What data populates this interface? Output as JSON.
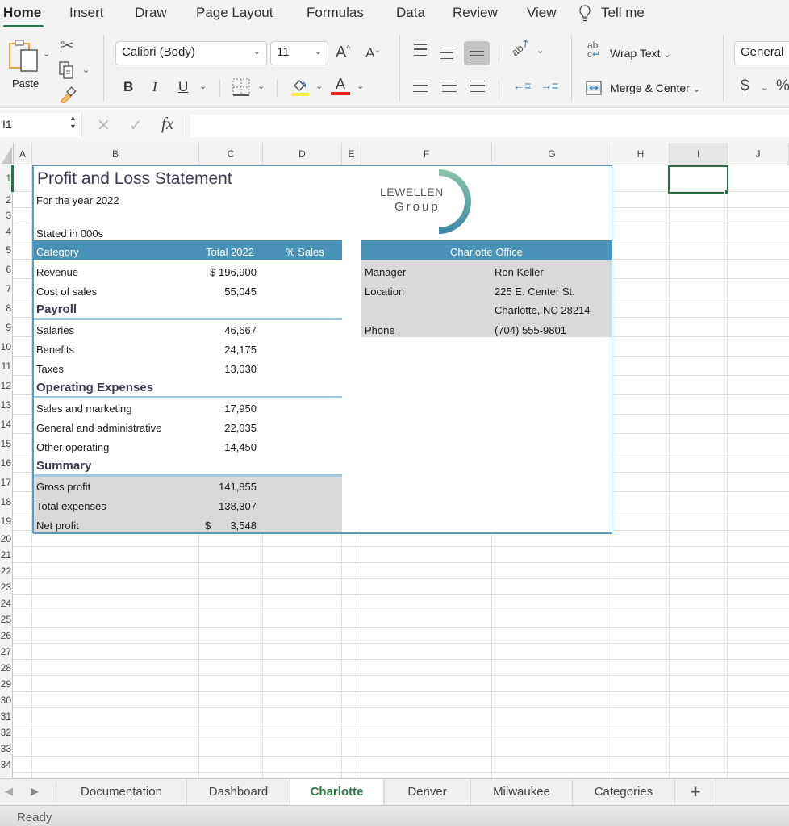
{
  "menu": {
    "tabs": [
      "Home",
      "Insert",
      "Draw",
      "Page Layout",
      "Formulas",
      "Data",
      "Review",
      "View"
    ],
    "active": "Home",
    "tell_me": "Tell me"
  },
  "ribbon": {
    "paste_label": "Paste",
    "font_name": "Calibri (Body)",
    "font_size": "11",
    "bold": "B",
    "italic": "I",
    "underline": "U",
    "font_grow": "A",
    "font_shrink": "A",
    "font_color": "A",
    "wrap_text": "Wrap Text",
    "merge_center": "Merge & Center",
    "number_format": "General",
    "currency": "$",
    "percent": "%",
    "fill_color": "#f7ef3b",
    "text_color": "#e2231a"
  },
  "formula_bar": {
    "name_box": "I1",
    "fx": "fx",
    "value": ""
  },
  "columns": [
    "A",
    "B",
    "C",
    "D",
    "E",
    "F",
    "G",
    "H",
    "I",
    "J"
  ],
  "rows": [
    "1",
    "2",
    "3",
    "4",
    "5",
    "6",
    "7",
    "8",
    "9",
    "10",
    "11",
    "12",
    "13",
    "14",
    "15",
    "16",
    "17",
    "18",
    "19",
    "20",
    "21",
    "22",
    "23",
    "24",
    "25",
    "26",
    "27",
    "28",
    "29",
    "30",
    "31",
    "32",
    "33",
    "34"
  ],
  "sheet": {
    "title": "Profit and Loss Statement",
    "subtitle": "For the year 2022",
    "stated": "Stated in 000s",
    "header": {
      "category": "Category",
      "total": "Total 2022",
      "pct": "% Sales"
    },
    "revenue": {
      "label": "Revenue",
      "value": "$ 196,900"
    },
    "cost": {
      "label": "Cost of sales",
      "value": "55,045"
    },
    "payroll": {
      "title": "Payroll",
      "items": [
        {
          "label": "Salaries",
          "value": "46,667"
        },
        {
          "label": "Benefits",
          "value": "24,175"
        },
        {
          "label": "Taxes",
          "value": "13,030"
        }
      ]
    },
    "opex": {
      "title": "Operating Expenses",
      "items": [
        {
          "label": "Sales and marketing",
          "value": "17,950"
        },
        {
          "label": "General and administrative",
          "value": "22,035"
        },
        {
          "label": "Other operating",
          "value": "14,450"
        }
      ]
    },
    "summary": {
      "title": "Summary",
      "items": [
        {
          "label": "Gross profit",
          "value": "141,855"
        },
        {
          "label": "Total expenses",
          "value": "138,307"
        },
        {
          "label": "Net profit",
          "dollar": "$",
          "value": "3,548"
        }
      ]
    },
    "logo": {
      "line1": "LEWELLEN",
      "line2": "Group"
    },
    "office": {
      "title": "Charlotte Office",
      "manager_label": "Manager",
      "manager": "Ron Keller",
      "location_label": "Location",
      "address1": "225 E. Center St.",
      "address2": "Charlotte, NC 28214",
      "phone_label": "Phone",
      "phone": "(704) 555-9801"
    },
    "accent_color": "#4b92b8"
  },
  "sheet_tabs": [
    "Documentation",
    "Dashboard",
    "Charlotte",
    "Denver",
    "Milwaukee",
    "Categories"
  ],
  "active_sheet": "Charlotte",
  "add_sheet": "+",
  "status": "Ready"
}
